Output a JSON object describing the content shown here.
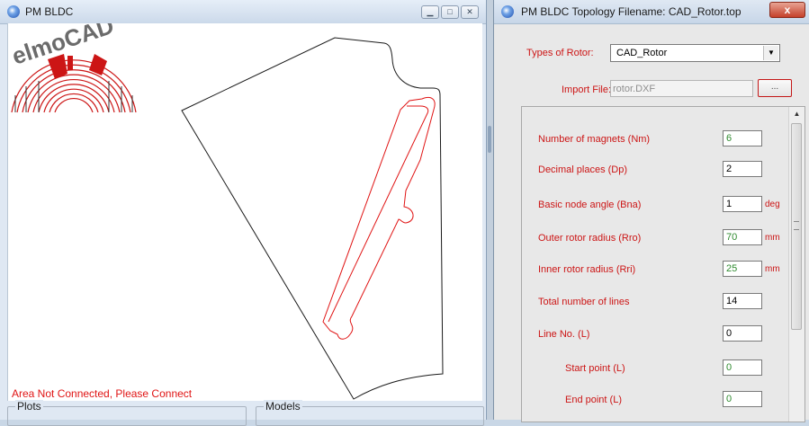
{
  "left_window": {
    "title": "PM BLDC",
    "logo_text": "elmoCAD",
    "status_text": "Area Not Connected, Please Connect",
    "groups": {
      "plots": "Plots",
      "models": "Models"
    }
  },
  "right_window": {
    "title": "PM BLDC  Topology Filename: CAD_Rotor.top",
    "close_glyph": "x",
    "types_label": "Types of Rotor:",
    "types_value": "CAD_Rotor",
    "import_label": "Import File:",
    "import_value": "rotor.DXF",
    "browse_label": "...",
    "params": [
      {
        "label": "Number of magnets  (Nm)",
        "value": "6",
        "unit": ""
      },
      {
        "label": "Decimal places  (Dp)",
        "value": "2",
        "unit": ""
      },
      {
        "label": "Basic node angle  (Bna)",
        "value": "1",
        "unit": "deg"
      },
      {
        "label": "Outer rotor radius  (Rro)",
        "value": "70",
        "unit": "mm"
      },
      {
        "label": "Inner rotor radius  (Rri)",
        "value": "25",
        "unit": "mm"
      },
      {
        "label": "Total number of lines",
        "value": "14",
        "unit": ""
      },
      {
        "label": "Line No.  (L)",
        "value": "0",
        "unit": ""
      },
      {
        "label": "Start point  (L)",
        "value": "0",
        "unit": ""
      },
      {
        "label": "End point  (L)",
        "value": "0",
        "unit": ""
      }
    ]
  },
  "colors": {
    "accent_red": "#cc1515",
    "value_green": "#2f8a2f",
    "status_red": "#e01414"
  }
}
